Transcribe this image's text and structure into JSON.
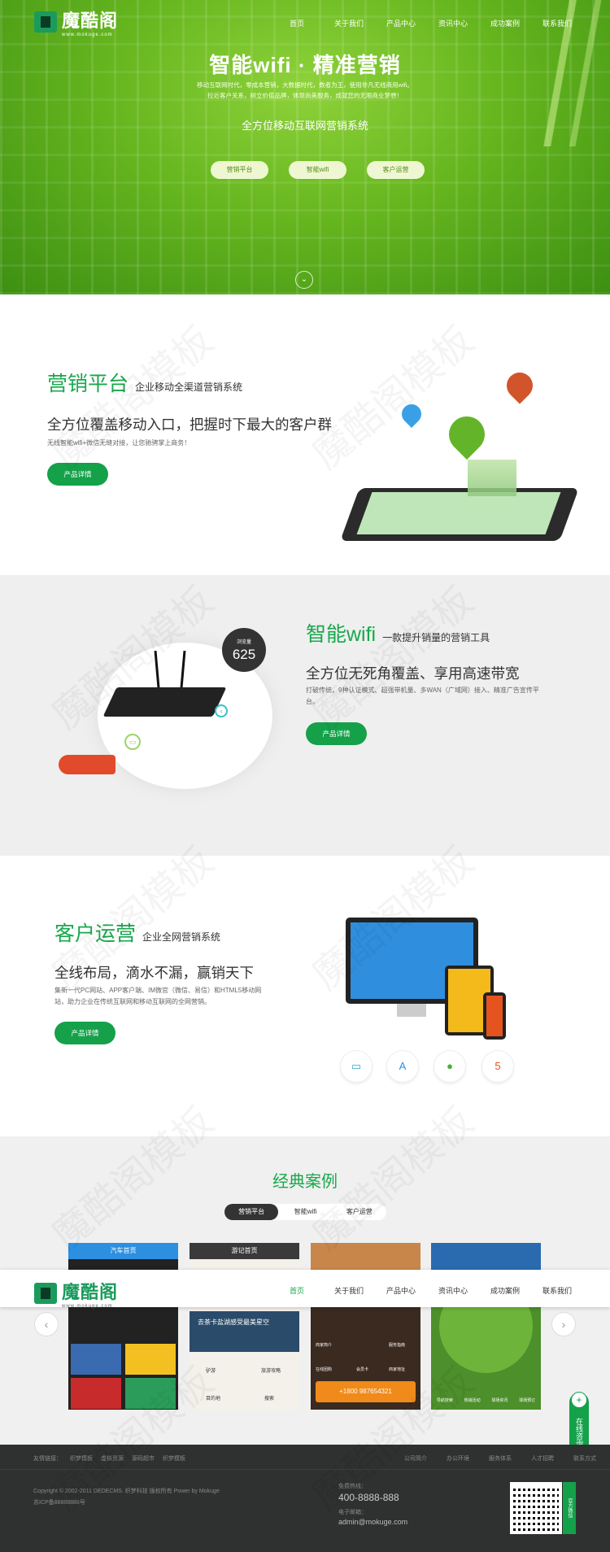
{
  "header": {
    "logo_text": "魔酷阁",
    "logo_sub": "www.mokuge.com",
    "nav": [
      "首页",
      "关于我们",
      "产品中心",
      "资讯中心",
      "成功案例",
      "联系我们"
    ]
  },
  "hero": {
    "title": "智能wifi · 精准营销",
    "desc_line1": "移动互联网时代，零成本营销，大数据时代，数者为王，使用非凡无线商用wifi。",
    "desc_line2": "拉近客户关系，树立价值品牌，体现尚美服务，成就您的无限商业梦想！",
    "subtitle": "全方位移动互联网营销系统",
    "buttons": [
      "营销平台",
      "智能wifi",
      "客户运营"
    ]
  },
  "section_marketing": {
    "title": "营销平台",
    "subtitle": "企业移动全渠道营销系统",
    "slogan": "全方位覆盖移动入口，把握时下最大的客户群",
    "text": "无线智能wifi+微信无缝对接，让您驰骋掌上商务！",
    "button": "产品详情"
  },
  "section_wifi": {
    "title": "智能wifi",
    "subtitle": "一款提升销量的营销工具",
    "slogan": "全方位无死角覆盖、享用高速带宽",
    "text_line1": "打破传统，9种认证模式、超强带机量、多WAN（广域网）接入、精准广告宣传平",
    "text_line2": "台。",
    "button": "产品详情",
    "counter_label": "浏览量",
    "counter_value": "625"
  },
  "section_customer": {
    "title": "客户运营",
    "subtitle": "企业全网营销系统",
    "slogan": "全线布局，滴水不漏，赢销天下",
    "text_line1": "集新一代PC网站、APP客户端、IM微官（微信、易信）和HTML5移动网",
    "text_line2": "站，助力企业在传统互联网和移动互联网的全网营销。",
    "button": "产品详情"
  },
  "cases": {
    "title": "经典案例",
    "tabs": [
      "营销平台",
      "智能wifi",
      "客户运营"
    ],
    "items": [
      {
        "header": "汽车首页"
      },
      {
        "header": "游记首页",
        "banner": "去茶卡盐湖感受最美星空",
        "menu": [
          "驴游",
          "旅游攻略",
          "目的地",
          "搜索"
        ]
      },
      {
        "phone": "+1800 987654321",
        "menu": [
          "商家简介",
          "服务指南",
          "在线团购",
          "会员卡",
          "商家地址"
        ]
      },
      {
        "menu": [
          "导航搜索",
          "热销活动",
          "球场资讯",
          "球场预订"
        ]
      }
    ]
  },
  "footer": {
    "links_label": "友情链接：",
    "links": [
      "织梦模板",
      "虚拟资源",
      "源码超市",
      "织梦模板"
    ],
    "right_links": [
      "公司简介",
      "办公环境",
      "服务体系",
      "人才招聘",
      "联系方式"
    ],
    "copyright": "Copyright © 2002-2011 DEDECMS. 织梦科技 版权所有 Power by Mokuge",
    "icp": "苏ICP备88888888号",
    "hotline_label": "免费热线：",
    "hotline": "400-8888-888",
    "email_label": "电子邮箱：",
    "email": "admin@mokuge.com",
    "qr_label": "官方微信"
  },
  "float": {
    "label": "在线咨询"
  },
  "watermark": "魔酷阁模板",
  "colors": {
    "brand_green": "#14a14a",
    "title_green": "#18a84c",
    "footer_bg": "#2f3130"
  }
}
